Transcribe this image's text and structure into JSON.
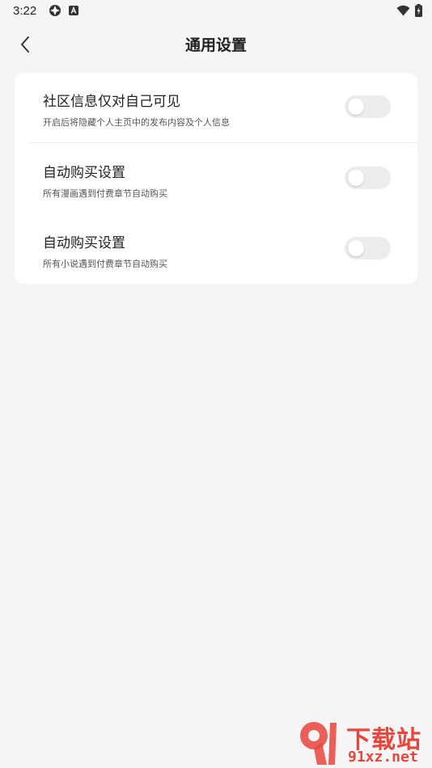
{
  "status_bar": {
    "time": "3:22"
  },
  "header": {
    "title": "通用设置"
  },
  "settings": [
    {
      "title": "社区信息仅对自己可见",
      "description": "开启后将隐藏个人主页中的发布内容及个人信息",
      "enabled": false
    },
    {
      "title": "自动购买设置",
      "description": "所有漫画遇到付费章节自动购买",
      "enabled": false
    },
    {
      "title": "自动购买设置",
      "description": "所有小说遇到付费章节自动购买",
      "enabled": false
    }
  ],
  "watermark": {
    "brand": "下载站",
    "url": "91xz.net"
  },
  "colors": {
    "background": "#f5f5f5",
    "card": "#ffffff",
    "toggle_off": "#ececec",
    "watermark": "#e8453c"
  }
}
